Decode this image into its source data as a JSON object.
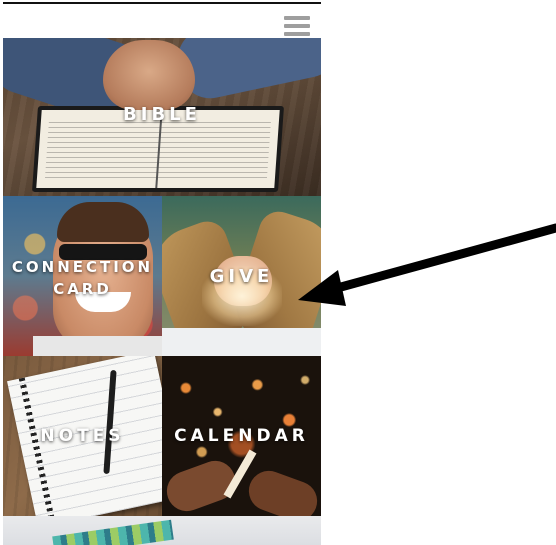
{
  "header": {
    "menu_icon": "hamburger-menu-icon",
    "menu_color": "#9e9e9e"
  },
  "tiles": [
    {
      "key": "bible",
      "label": "BIBLE"
    },
    {
      "key": "connection",
      "label_line1": "CONNECTION",
      "label_line2": "CARD"
    },
    {
      "key": "give",
      "label": "GIVE"
    },
    {
      "key": "notes",
      "label": "NOTES"
    },
    {
      "key": "calendar",
      "label": "CALENDAR"
    }
  ],
  "annotation": {
    "type": "arrow",
    "points_to": "give",
    "color": "#000000"
  }
}
